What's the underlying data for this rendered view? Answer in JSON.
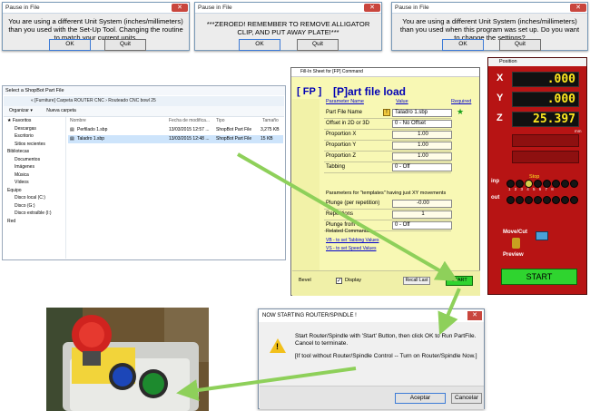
{
  "pause_dialogs": [
    {
      "title": "Pause in File",
      "message": "You are using a different Unit System (inches/millimeters) than you used with the Set-Up Tool. Changing the routine to match your current units.",
      "ok": "OK",
      "quit": "Quit"
    },
    {
      "title": "Pause in File",
      "message": "***ZEROED! REMEMBER TO REMOVE ALLIGATOR CLIP, AND PUT AWAY PLATE!***",
      "ok": "OK",
      "quit": "Quit"
    },
    {
      "title": "Pause in File",
      "message": "You are using a different Unit System (inches/millimeters) than you used when this program was set up. Do you want to change the settings?",
      "ok": "OK",
      "quit": "Quit"
    }
  ],
  "close_glyph": "✕",
  "file_explorer": {
    "title": "Select a ShopBot Part File",
    "path": "« [Furniture] Carpeta ROUTER CNC › Routeado CNC bowl 25",
    "toolbar": {
      "organize": "Organizar ▾",
      "new_folder": "Nueva carpeta"
    },
    "sidebar": [
      "★ Favoritos",
      "Descargas",
      "Escritorio",
      "Sitios recientes",
      "",
      "Bibliotecas",
      "Documentos",
      "Imágenes",
      "Música",
      "Vídeos",
      "",
      "Equipo",
      "Disco local (C:)",
      "Disco (G:)",
      "Disco extraíble (I:)",
      "",
      "Red"
    ],
    "columns": {
      "name": "Nombre",
      "date": "Fecha de modifica...",
      "type": "Tipo",
      "size": "Tamaño"
    },
    "rows": [
      {
        "name": "Perfilado 1.sbp",
        "date": "13/03/2015 12:57 ...",
        "type": "ShopBot Part File",
        "size": "3,275 KB"
      },
      {
        "name": "Taladro 1.sbp",
        "date": "13/03/2015 12:48 ...",
        "type": "ShopBot Part File",
        "size": "15 KB"
      }
    ]
  },
  "fill_in": {
    "window_title": "Fill-In Sheet for [FP] Command",
    "cmd": "[ FP ]",
    "heading": "[P]art file load",
    "col_name": "Parameter Name",
    "col_value": "Value",
    "required": "Required",
    "params": [
      {
        "label": "Part File Name",
        "value": "Taladro 1.sbp"
      },
      {
        "label": "Offset in 2D or 3D",
        "value": "0 - No Offset"
      },
      {
        "label": "Proportion X",
        "value": "1.00"
      },
      {
        "label": "Proportion Y",
        "value": "1.00"
      },
      {
        "label": "Proportion Z",
        "value": "1.00"
      },
      {
        "label": "Tabbing",
        "value": "0 - Off"
      }
    ],
    "templates_note": "Parameters for \"templates\" having just XY movements",
    "params2": [
      {
        "label": "Plunge (per repetition)",
        "value": "-0.00"
      },
      {
        "label": "Repetitions",
        "value": "1"
      },
      {
        "label": "Plunge from 0",
        "value": "0 - Off"
      }
    ],
    "related": "Related Commands:",
    "link1": "VB - to set Tabbing Values",
    "link2": "VS - to set Speed Values",
    "bevel": "Bevel",
    "display": "Display",
    "recall": "Recall Last",
    "start": "START"
  },
  "position": {
    "title": "Position",
    "x_label": "X",
    "x_value": ".000",
    "y_label": "Y",
    "y_value": ".000",
    "z_label": "Z",
    "z_value": "25.397",
    "units": "mm",
    "stop": "Stop",
    "inp": "inp",
    "out": "out",
    "inp_nums": "1 2 3 4 5 6 7 8",
    "move_cut": "Move/Cut",
    "preview": "Preview",
    "start": "START"
  },
  "now_starting": {
    "title": "NOW STARTING ROUTER/SPINDLE !",
    "line1": "Start Router/Spindle with 'Start' Button, then click OK to Run PartFile. Cancel to terminate.",
    "line2": "[If tool without Router/Spindle Control -- Turn on Router/Spindle Now.]",
    "accept": "Aceptar",
    "cancel": "Cancelar",
    "warn_glyph": "!"
  },
  "colors": {
    "arrow": "#8ed05a",
    "start_green": "#2fd42f",
    "led_yellow": "#ffe820"
  }
}
